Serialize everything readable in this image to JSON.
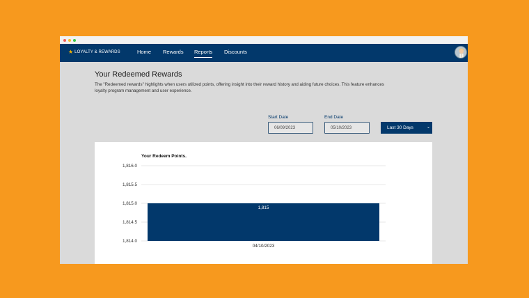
{
  "window": {
    "dots": [
      "#F25F58",
      "#F9BE2E",
      "#3AC84B"
    ]
  },
  "nav": {
    "logo_icon": "star-icon",
    "logo_text": "LOYALTY & REWARDS",
    "items": [
      {
        "label": "Home"
      },
      {
        "label": "Rewards"
      },
      {
        "label": "Reports",
        "active": true
      },
      {
        "label": "Discounts"
      }
    ],
    "brand_color": "#02386B"
  },
  "page": {
    "title": "Your Redeemed Rewards",
    "description": "The \"Redeemed rewards\" highlights when users utilized points, offering insight into their reward history and aiding future choices. This feature enhances loyalty program management and user experience."
  },
  "filters": {
    "start_label": "Start Date",
    "start_value": "06/09/2023",
    "end_label": "End Date",
    "end_value": "05/10/2023",
    "range_value": "Last 30 Days"
  },
  "chart_data": {
    "type": "bar",
    "title": "Your Redeem Points.",
    "categories": [
      "04/10/2023"
    ],
    "values": [
      1815
    ],
    "data_labels": [
      "1,815"
    ],
    "ylim": [
      1814.0,
      1816.0
    ],
    "yticks": [
      "1,814.0",
      "1,814.5",
      "1,815.0",
      "1,815.5",
      "1,816.0"
    ],
    "grid": true,
    "bar_color": "#02386B"
  }
}
